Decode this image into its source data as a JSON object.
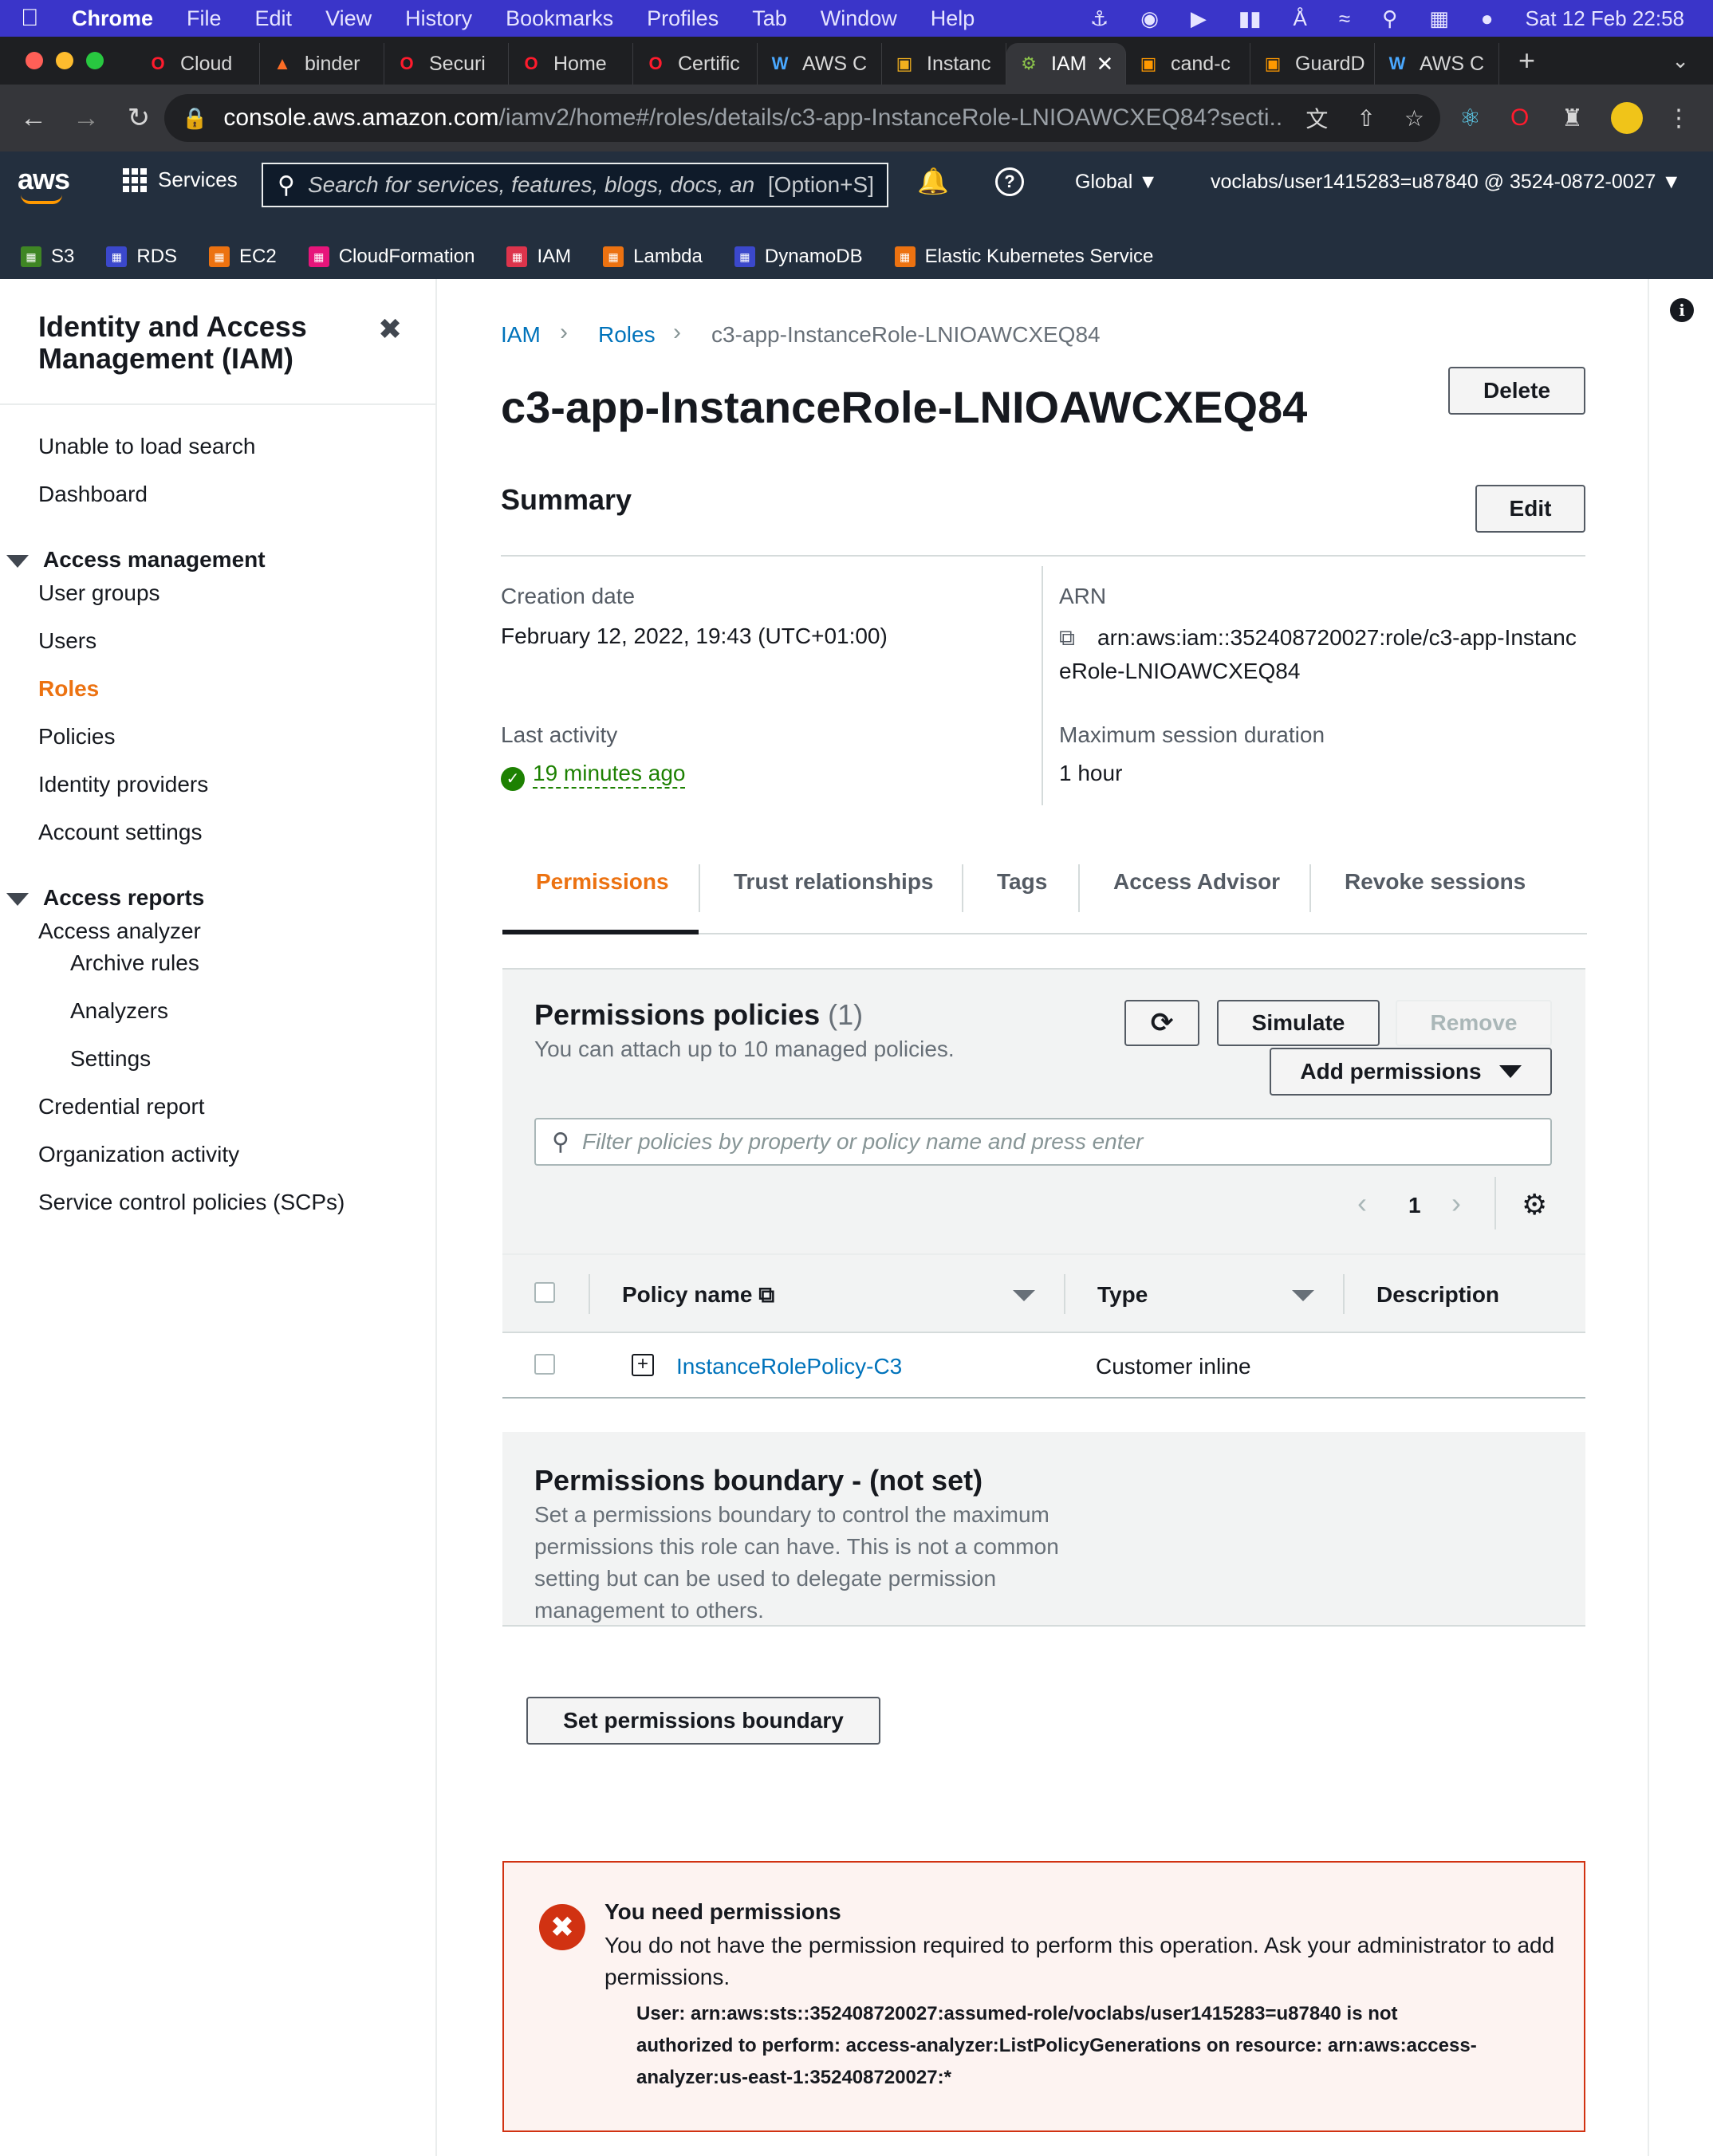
{
  "macos_menubar": {
    "app": "Chrome",
    "menus": [
      "File",
      "Edit",
      "View",
      "History",
      "Bookmarks",
      "Profiles",
      "Tab",
      "Window",
      "Help"
    ],
    "clock": "Sat 12 Feb  22:58"
  },
  "browser": {
    "tabs": [
      {
        "label": "Cloud",
        "icon": "opera-icon",
        "color": "#ff1b2d"
      },
      {
        "label": "binder",
        "icon": "gitlab-icon",
        "color": "#fc6d26"
      },
      {
        "label": "Securi",
        "icon": "opera-icon",
        "color": "#ff1b2d"
      },
      {
        "label": "Home",
        "icon": "opera-icon",
        "color": "#ff1b2d"
      },
      {
        "label": "Certific",
        "icon": "opera-icon",
        "color": "#ff1b2d"
      },
      {
        "label": "AWS C",
        "icon": "w-icon",
        "color": "#4aa8ff"
      },
      {
        "label": "Instanc",
        "icon": "box-icon",
        "color": "#f2b01e"
      },
      {
        "label": "IAM",
        "icon": "iam-icon",
        "color": "#8bc34a",
        "active": true
      },
      {
        "label": "cand-c",
        "icon": "aws-box-icon",
        "color": "#ff9900"
      },
      {
        "label": "GuardD",
        "icon": "aws-box-icon",
        "color": "#ff9900"
      },
      {
        "label": "AWS C",
        "icon": "w-icon",
        "color": "#4aa8ff"
      }
    ],
    "url_host": "console.aws.amazon.com",
    "url_path": "/iamv2/home#/roles/details/c3-app-InstanceRole-LNIOAWCXEQ84?secti..."
  },
  "aws_nav": {
    "logo": "aws",
    "services": "Services",
    "search_placeholder": "Search for services, features, blogs, docs, an",
    "search_hint": "[Option+S]",
    "region": "Global",
    "account": "voclabs/user1415283=u87840 @ 3524-0872-0027",
    "shortcuts": [
      {
        "label": "S3",
        "color": "#3f8624"
      },
      {
        "label": "RDS",
        "color": "#3b48cc"
      },
      {
        "label": "EC2",
        "color": "#ec7211"
      },
      {
        "label": "CloudFormation",
        "color": "#e7157b"
      },
      {
        "label": "IAM",
        "color": "#dd344c"
      },
      {
        "label": "Lambda",
        "color": "#ec7211"
      },
      {
        "label": "DynamoDB",
        "color": "#3b48cc"
      },
      {
        "label": "Elastic Kubernetes Service",
        "color": "#ec7211"
      }
    ]
  },
  "sidebar": {
    "title": "Identity and Access Management (IAM)",
    "top_items": [
      "Unable to load search",
      "Dashboard"
    ],
    "access_management": {
      "heading": "Access management",
      "items": [
        "User groups",
        "Users",
        "Roles",
        "Policies",
        "Identity providers",
        "Account settings"
      ],
      "active": "Roles"
    },
    "access_reports": {
      "heading": "Access reports",
      "items": [
        "Access analyzer",
        "Archive rules",
        "Analyzers",
        "Settings",
        "Credential report",
        "Organization activity",
        "Service control policies (SCPs)"
      ]
    }
  },
  "breadcrumb": [
    "IAM",
    "Roles",
    "c3-app-InstanceRole-LNIOAWCXEQ84"
  ],
  "role": {
    "name": "c3-app-InstanceRole-LNIOAWCXEQ84",
    "delete_label": "Delete",
    "summary_title": "Summary",
    "edit_label": "Edit",
    "creation_date_label": "Creation date",
    "creation_date": "February 12, 2022, 19:43 (UTC+01:00)",
    "arn_label": "ARN",
    "arn_line1": "arn:aws:iam::352408720027:role/c3-app-Instanc",
    "arn_line2": "eRole-LNIOAWCXEQ84",
    "last_activity_label": "Last activity",
    "last_activity": "19 minutes ago",
    "max_session_label": "Maximum session duration",
    "max_session": "1 hour"
  },
  "tabs": [
    "Permissions",
    "Trust relationships",
    "Tags",
    "Access Advisor",
    "Revoke sessions"
  ],
  "permissions_policies": {
    "title": "Permissions policies",
    "count": "(1)",
    "subtitle": "You can attach up to 10 managed policies.",
    "simulate_label": "Simulate",
    "remove_label": "Remove",
    "add_label": "Add permissions",
    "filter_placeholder": "Filter policies by property or policy name and press enter",
    "page": "1",
    "columns": [
      "Policy name",
      "Type",
      "Description"
    ],
    "rows": [
      {
        "name": "InstanceRolePolicy-C3",
        "type": "Customer inline",
        "description": ""
      }
    ]
  },
  "boundary": {
    "title": "Permissions boundary - (not set)",
    "description": "Set a permissions boundary to control the maximum permissions this role can have. This is not a common setting but can be used to delegate permission management to others.",
    "button": "Set permissions boundary"
  },
  "error": {
    "title": "You need permissions",
    "body": "You do not have the permission required to perform this operation. Ask your administrator to add permissions.",
    "detail": "User: arn:aws:sts::352408720027:assumed-role/voclabs/user1415283=u87840 is not authorized to perform: access-analyzer:ListPolicyGenerations on resource: arn:aws:access-analyzer:us-east-1:352408720027:*"
  }
}
